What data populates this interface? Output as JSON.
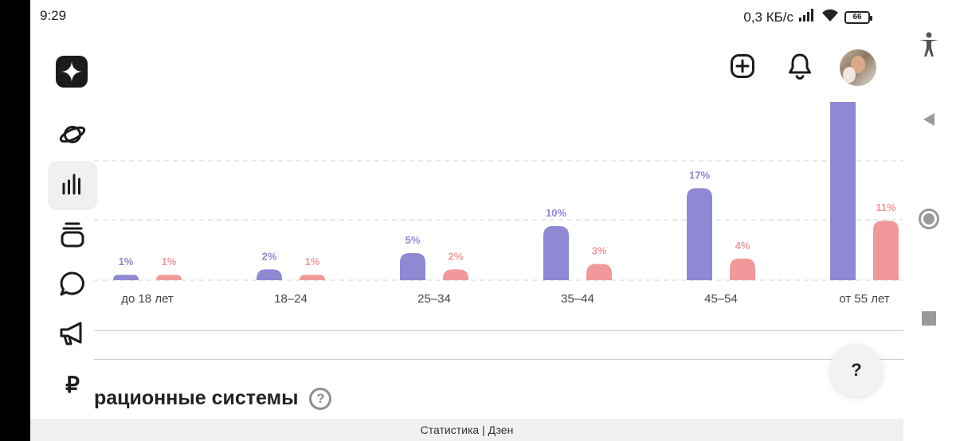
{
  "status_bar": {
    "time": "9:29",
    "speed": "0,3 КБ/с",
    "battery": "66"
  },
  "header": {
    "logo_icon": "dzen-star-icon",
    "add_icon": "add-icon",
    "bell_icon": "bell-icon"
  },
  "sidebar": {
    "items": [
      {
        "icon": "planet-icon",
        "active": false
      },
      {
        "icon": "stats-icon",
        "active": true
      },
      {
        "icon": "stack-icon",
        "active": false
      },
      {
        "icon": "comment-icon",
        "active": false
      },
      {
        "icon": "megaphone-icon",
        "active": false
      },
      {
        "icon": "ruble-icon",
        "label": "₽",
        "active": false
      }
    ]
  },
  "chart_data": {
    "type": "bar",
    "categories": [
      "до 18 лет",
      "18–24",
      "25–34",
      "35–44",
      "45–54",
      "от 55 лет"
    ],
    "series": [
      {
        "color": "#8f88d3",
        "values": [
          1,
          2,
          5,
          10,
          17,
          null
        ],
        "labels": [
          "1%",
          "2%",
          "5%",
          "10%",
          "17%",
          ""
        ]
      },
      {
        "color": "#f1999a",
        "values": [
          1,
          1,
          2,
          3,
          4,
          11
        ],
        "labels": [
          "1%",
          "1%",
          "2%",
          "3%",
          "4%",
          "11%"
        ]
      }
    ],
    "grid": true
  },
  "section": {
    "title": "рационные системы",
    "help": "?"
  },
  "fab": {
    "label": "?"
  },
  "footer": {
    "text": "Статистика | Дзен"
  },
  "nav": {
    "accessibility_icon": "accessibility-icon",
    "back_icon": "back-icon",
    "home_icon": "home-icon",
    "recents_icon": "recents-icon"
  },
  "colors": {
    "purple": "#8f88d3",
    "pink": "#f1999a",
    "grid": "#dcdcdc"
  }
}
